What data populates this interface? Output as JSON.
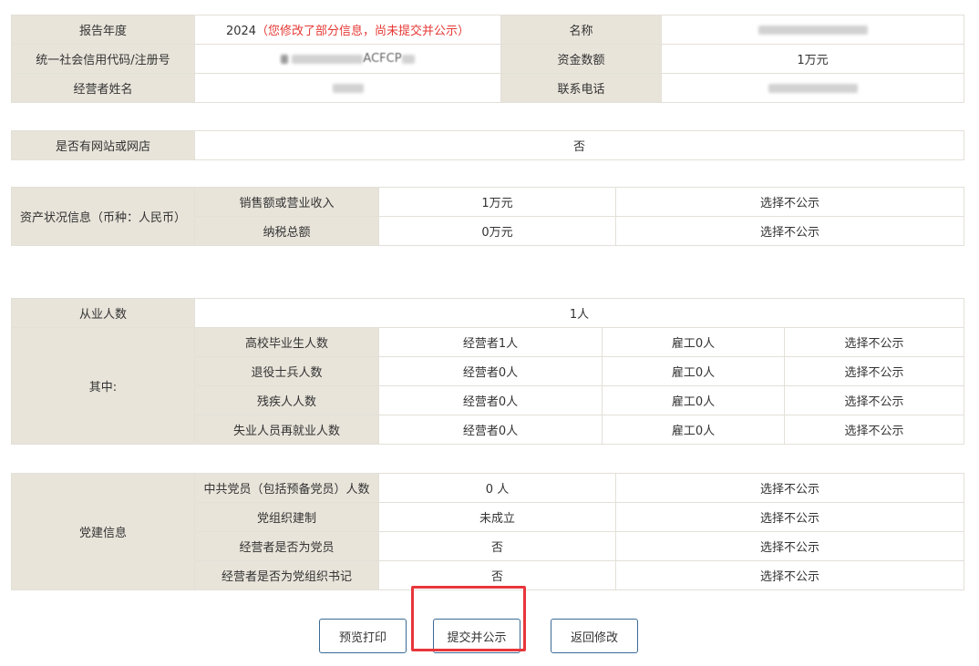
{
  "basic": {
    "report_year_label": "报告年度",
    "report_year_value": "2024",
    "report_year_note": "（您修改了部分信息，尚未提交并公示）",
    "name_label": "名称",
    "credit_code_label": "统一社会信用代码/注册号",
    "credit_code_partial": "ACFCP",
    "capital_label": "资金数额",
    "capital_value": "1万元",
    "operator_name_label": "经营者姓名",
    "phone_label": "联系电话"
  },
  "website": {
    "label": "是否有网站或网店",
    "value": "否"
  },
  "assets": {
    "group_label": "资产状况信息（币种：人民币）",
    "rows": [
      {
        "label": "销售额或营业收入",
        "value": "1万元",
        "visibility": "选择不公示"
      },
      {
        "label": "纳税总额",
        "value": "0万元",
        "visibility": "选择不公示"
      }
    ]
  },
  "employees": {
    "label": "从业人数",
    "value": "1人",
    "group_label": "其中:",
    "rows": [
      {
        "label": "高校毕业生人数",
        "operator": "经营者1人",
        "employee": "雇工0人",
        "visibility": "选择不公示"
      },
      {
        "label": "退役士兵人数",
        "operator": "经营者0人",
        "employee": "雇工0人",
        "visibility": "选择不公示"
      },
      {
        "label": "残疾人人数",
        "operator": "经营者0人",
        "employee": "雇工0人",
        "visibility": "选择不公示"
      },
      {
        "label": "失业人员再就业人数",
        "operator": "经营者0人",
        "employee": "雇工0人",
        "visibility": "选择不公示"
      }
    ]
  },
  "party": {
    "group_label": "党建信息",
    "rows": [
      {
        "label": "中共党员（包括预备党员）人数",
        "value": "0 人",
        "visibility": "选择不公示"
      },
      {
        "label": "党组织建制",
        "value": "未成立",
        "visibility": "选择不公示"
      },
      {
        "label": "经营者是否为党员",
        "value": "否",
        "visibility": "选择不公示"
      },
      {
        "label": "经营者是否为党组织书记",
        "value": "否",
        "visibility": "选择不公示"
      }
    ]
  },
  "buttons": {
    "preview_print": "预览打印",
    "submit_publish": "提交并公示",
    "back_edit": "返回修改"
  },
  "colors": {
    "label_bg": "#e8e4da",
    "border": "#e3e0d8",
    "note_red": "#e53935",
    "button_border": "#3a6a96",
    "highlight_red": "#e8363b"
  }
}
